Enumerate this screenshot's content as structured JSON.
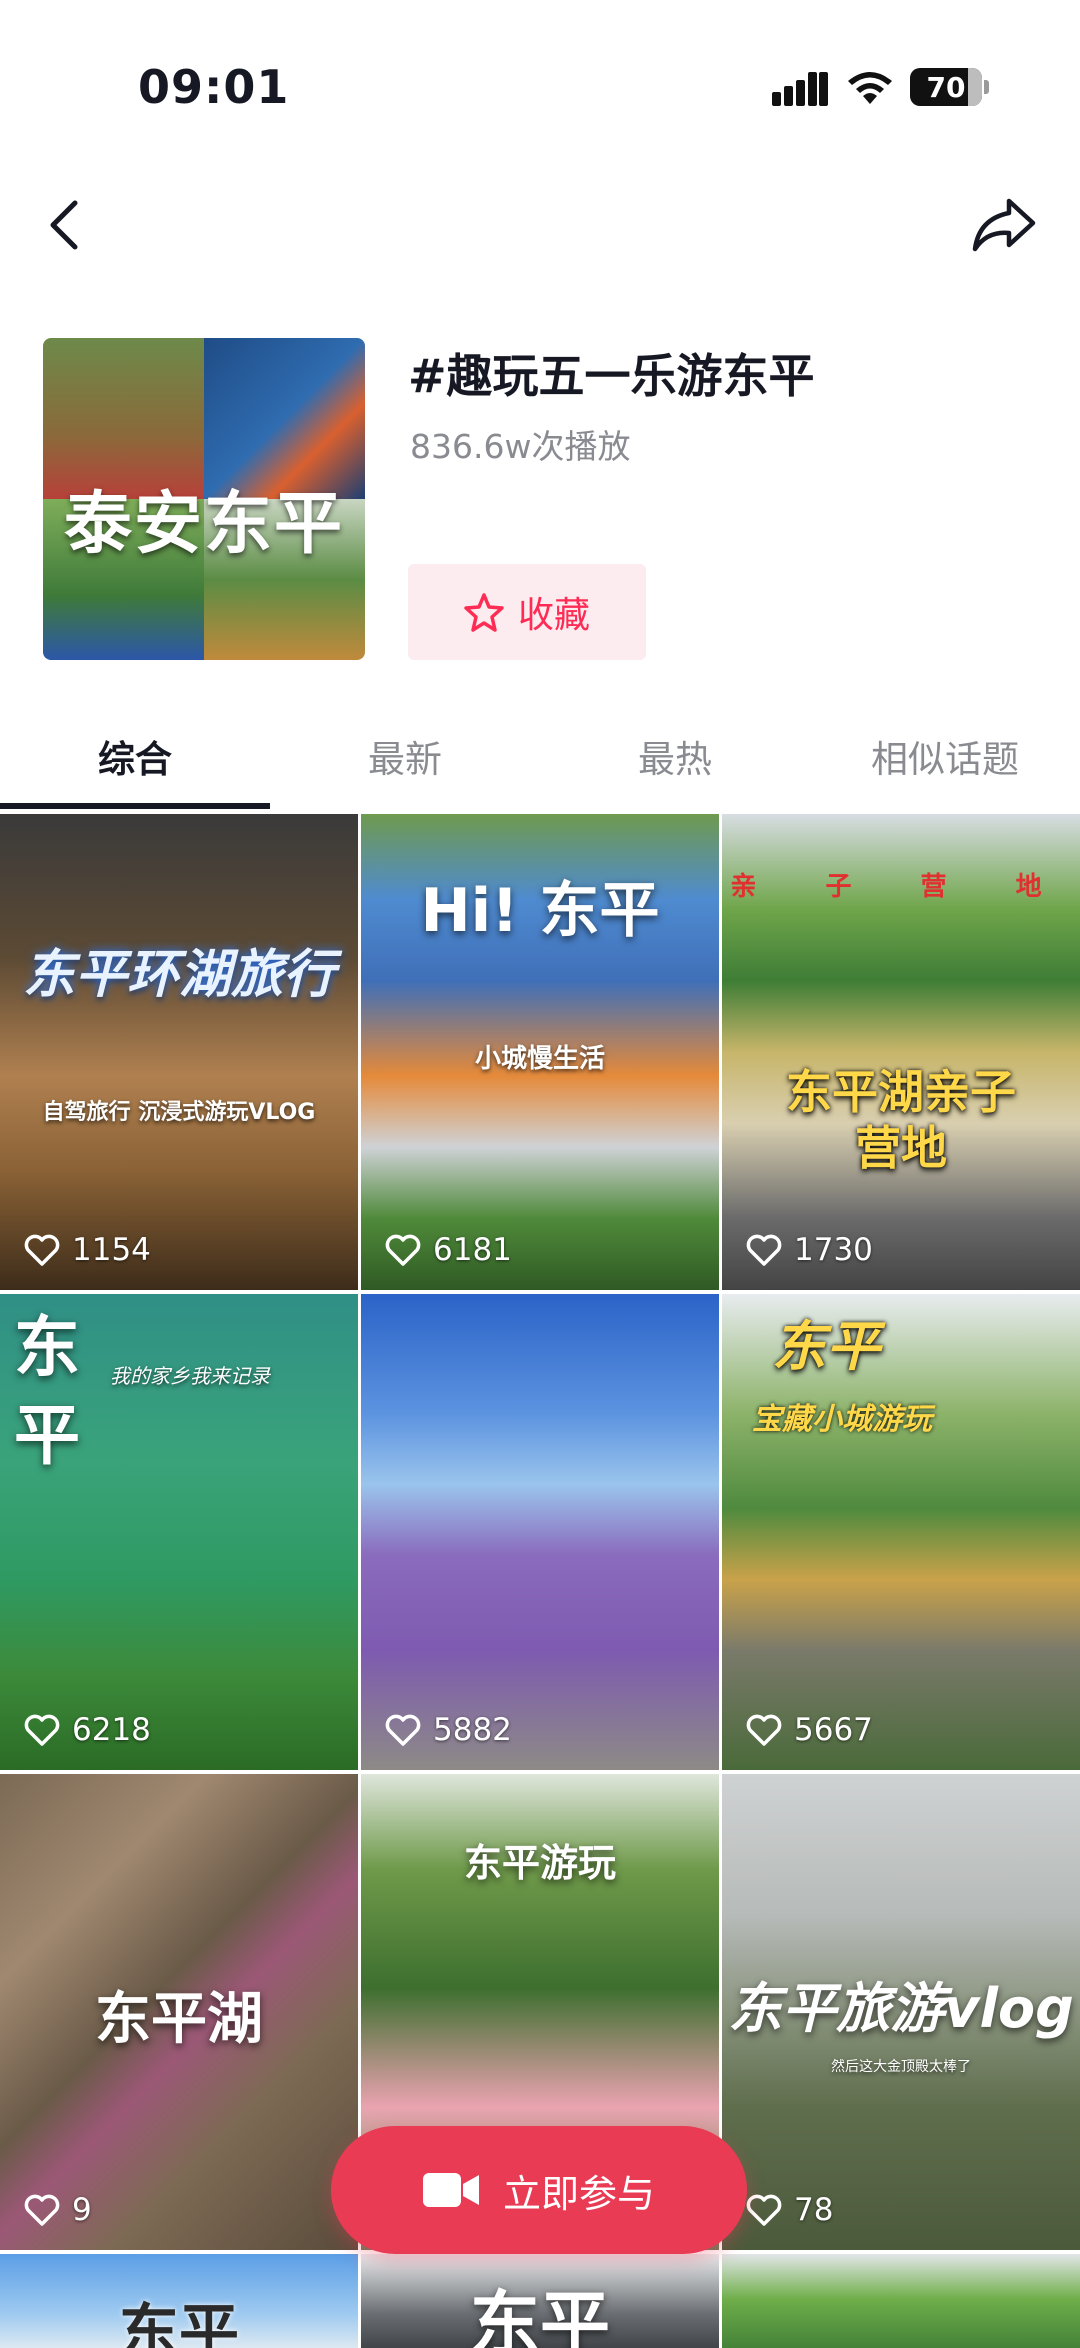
{
  "status_bar": {
    "time": "09:01",
    "battery": "70"
  },
  "topic": {
    "cover_text": "泰安东平",
    "title": "#趣玩五一乐游东平",
    "plays": "836.6w次播放",
    "favorite_label": "收藏"
  },
  "tabs": [
    {
      "label": "综合",
      "active": true
    },
    {
      "label": "最新",
      "active": false
    },
    {
      "label": "最热",
      "active": false
    },
    {
      "label": "相似话题",
      "active": false
    }
  ],
  "videos": [
    {
      "title": "东平环湖旅行",
      "subtitle": "自驾旅行 沉浸式游玩VLOG",
      "likes": "1154"
    },
    {
      "title": "Hi! 东平",
      "subtitle": "小城慢生活",
      "likes": "6181"
    },
    {
      "title": "东平湖亲子营地",
      "subtitle": "亲 子 营 地",
      "likes": "1730"
    },
    {
      "title": "东平",
      "subtitle": "我的家乡我来记录",
      "likes": "6218"
    },
    {
      "title": "",
      "subtitle": "",
      "likes": "5882"
    },
    {
      "title": "东平",
      "subtitle": "宝藏小城游玩",
      "likes": "5667"
    },
    {
      "title": "东平湖",
      "subtitle": "",
      "likes": "9"
    },
    {
      "title": "东平游玩",
      "subtitle": "",
      "likes": ""
    },
    {
      "title": "东平旅游vlog",
      "subtitle": "然后这大金顶殿太棒了",
      "likes": "78"
    },
    {
      "title": "东平",
      "subtitle": "",
      "likes": ""
    },
    {
      "title": "东平",
      "subtitle": "",
      "likes": ""
    },
    {
      "title": "",
      "subtitle": "",
      "likes": ""
    }
  ],
  "cta": {
    "label": "立即参与"
  }
}
